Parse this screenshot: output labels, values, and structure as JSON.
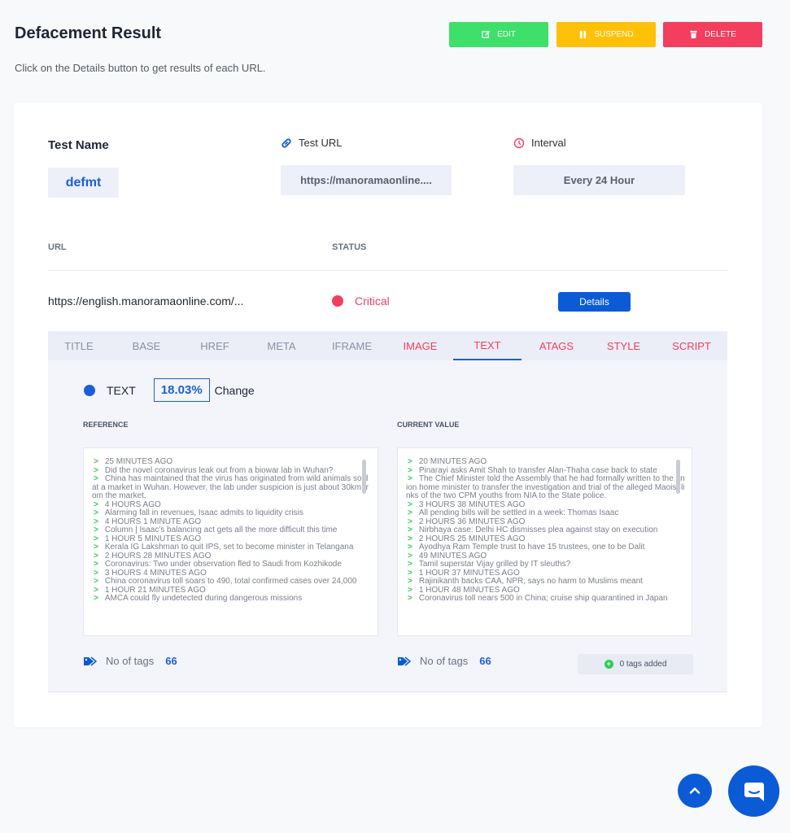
{
  "header": {
    "title": "Defacement Result",
    "subtitle": "Click on the Details button to get results of each URL.",
    "edit_label": "EDIT",
    "suspend_label": "SUSPEND",
    "delete_label": "DELETE"
  },
  "test": {
    "name_label": "Test Name",
    "name_value": "defmt",
    "url_label": "Test URL",
    "url_value": "https://manoramaonline....",
    "interval_label": "Interval",
    "interval_value": "Every 24 Hour"
  },
  "table": {
    "col_url": "URL",
    "col_status": "STATUS",
    "row_url": "https://english.manoramaonline.com/...",
    "row_status": "Critical",
    "details_label": "Details"
  },
  "tabs": [
    "TITLE",
    "BASE",
    "HREF",
    "META",
    "IFRAME",
    "IMAGE",
    "TEXT",
    "ATAGS",
    "STYLE",
    "SCRIPT"
  ],
  "active_tab": "TEXT",
  "result": {
    "type_label": "TEXT",
    "change_percent": "18.03%",
    "change_label": "Change",
    "reference_heading": "REFERENCE",
    "current_heading": "CURRENT VALUE",
    "reference_lines": [
      {
        "arrow": true,
        "text": "25 MINUTES AGO"
      },
      {
        "arrow": true,
        "text": "Did the novel coronavirus leak out from a biowar lab in Wuhan?"
      },
      {
        "arrow": true,
        "text": "China has maintained that the virus has originated from wild animals sold at a market in Wuhan. However, the lab under suspicion is just about 30km from the market."
      },
      {
        "arrow": true,
        "text": "4 HOURS AGO"
      },
      {
        "arrow": true,
        "text": "Alarming fall in revenues, Isaac admits to liquidity crisis"
      },
      {
        "arrow": true,
        "text": "4 HOURS 1 MINUTE AGO"
      },
      {
        "arrow": true,
        "text": "Column | Isaac's balancing act gets all the more difficult this time"
      },
      {
        "arrow": true,
        "text": "1 HOUR 5 MINUTES AGO"
      },
      {
        "arrow": true,
        "text": "Kerala IG Lakshman to quit IPS, set to become minister in Telangana"
      },
      {
        "arrow": true,
        "text": "2 HOURS 28 MINUTES AGO"
      },
      {
        "arrow": true,
        "text": "Coronavirus: Two under observation fled to Saudi from Kozhikode"
      },
      {
        "arrow": true,
        "text": "3 HOURS 4 MINUTES AGO"
      },
      {
        "arrow": true,
        "text": "China coronavirus toll soars to 490, total confirmed cases over 24,000"
      },
      {
        "arrow": true,
        "text": "1 HOUR 21 MINUTES AGO"
      },
      {
        "arrow": true,
        "text": "AMCA could fly undetected during dangerous missions"
      }
    ],
    "current_lines": [
      {
        "arrow": true,
        "text": "20 MINUTES AGO"
      },
      {
        "arrow": true,
        "text": "Pinarayi asks Amit Shah to transfer Alan-Thaha case back to state"
      },
      {
        "arrow": true,
        "text": "The Chief Minister told the Assembly that he had formally written to the union home minister to transfer the investigation and trial of the alleged Maoist links of the two CPM youths from NIA to the State police."
      },
      {
        "arrow": true,
        "text": "3 HOURS 38 MINUTES AGO"
      },
      {
        "arrow": true,
        "text": "All pending bills will be settled in a week: Thomas Isaac"
      },
      {
        "arrow": true,
        "text": "2 HOURS 36 MINUTES AGO"
      },
      {
        "arrow": true,
        "text": "Nirbhaya case: Delhi HC dismisses plea against stay on execution"
      },
      {
        "arrow": true,
        "text": "2 HOURS 25 MINUTES AGO"
      },
      {
        "arrow": true,
        "text": "Ayodhya Ram Temple trust to have 15 trustees, one to be Dalit"
      },
      {
        "arrow": true,
        "text": "49 MINUTES AGO"
      },
      {
        "arrow": true,
        "text": "Tamil superstar Vijay grilled by IT sleuths?"
      },
      {
        "arrow": true,
        "text": "1 HOUR 37 MINUTES AGO"
      },
      {
        "arrow": true,
        "text": "Rajinikanth backs CAA, NPR; says no harm to Muslims meant"
      },
      {
        "arrow": true,
        "text": "1 HOUR 48 MINUTES AGO"
      },
      {
        "arrow": true,
        "text": "Coronavirus toll nears 500 in China; cruise ship quarantined in Japan"
      }
    ],
    "tags_label": "No of tags",
    "ref_tag_count": "66",
    "cur_tag_count": "66",
    "tags_added_label": "0 tags added"
  },
  "colors": {
    "primary": "#0b5bd6",
    "edit": "#3ee06a",
    "suspend": "#ffc107",
    "delete": "#f33e5e",
    "critical": "#f33e5e"
  },
  "icons": {
    "edit": "edit-icon",
    "suspend": "pause-icon",
    "delete": "trash-icon",
    "test_url": "link-icon",
    "interval": "clock-icon",
    "tags": "tag-icon",
    "tags_added": "plus-circle-icon",
    "scroll_top": "chevron-up-icon",
    "chat": "chat-icon"
  }
}
